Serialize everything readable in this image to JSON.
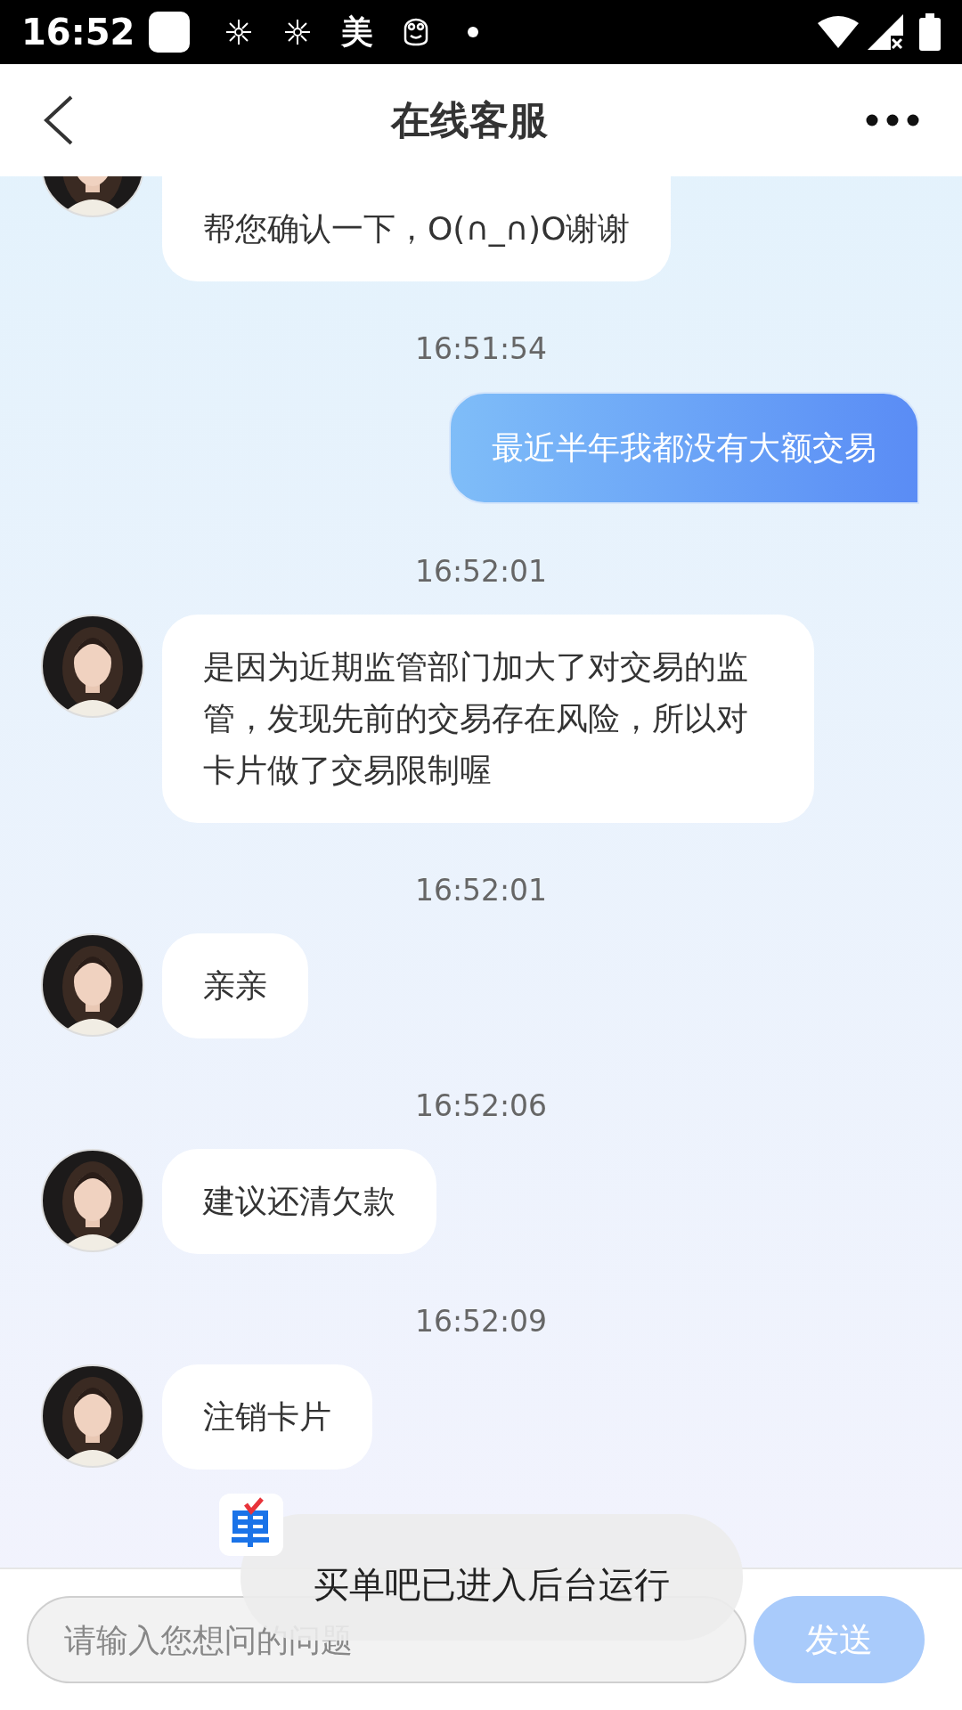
{
  "status_bar": {
    "time": "16:52",
    "notification_text": "美"
  },
  "header": {
    "title": "在线客服"
  },
  "messages": [
    {
      "kind": "agent",
      "text": "帮您确认一下，O(∩_∩)O谢谢"
    },
    {
      "kind": "timestamp",
      "text": "16:51:54"
    },
    {
      "kind": "user",
      "text": "最近半年我都没有大额交易"
    },
    {
      "kind": "timestamp",
      "text": "16:52:01"
    },
    {
      "kind": "agent",
      "text": "是因为近期监管部门加大了对交易的监管，发现先前的交易存在风险，所以对卡片做了交易限制喔"
    },
    {
      "kind": "timestamp",
      "text": "16:52:01"
    },
    {
      "kind": "agent",
      "text": "亲亲"
    },
    {
      "kind": "timestamp",
      "text": "16:52:06"
    },
    {
      "kind": "agent",
      "text": "建议还清欠款"
    },
    {
      "kind": "timestamp",
      "text": "16:52:09"
    },
    {
      "kind": "agent",
      "text": "注销卡片"
    }
  ],
  "input": {
    "placeholder": "请输入您想问的问题"
  },
  "send_button": {
    "label": "发送"
  },
  "toast": {
    "text": "买单吧已进入后台运行"
  }
}
